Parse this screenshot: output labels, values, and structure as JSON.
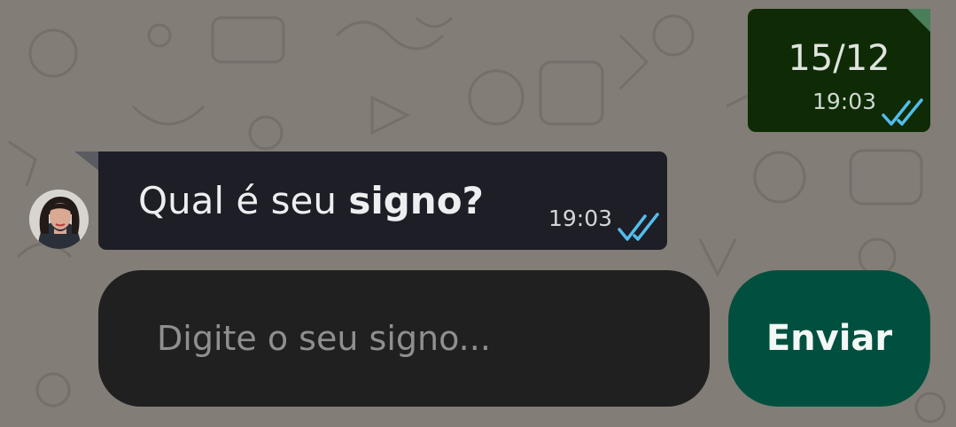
{
  "chat": {
    "outgoing_message": {
      "text": "15/12",
      "time": "19:03",
      "status_icon": "double-check-read-icon"
    },
    "incoming_message": {
      "text_plain": "Qual é seu ",
      "text_bold": "signo?",
      "time": "19:03",
      "status_icon": "double-check-read-icon",
      "sender_avatar": "avatar"
    }
  },
  "composer": {
    "value": "",
    "placeholder": "Digite o seu signo...",
    "send_label": "Enviar"
  },
  "colors": {
    "background": "#827d76",
    "outgoing_bubble": "#0e2b05",
    "incoming_bubble": "#1d1e26",
    "input_background": "#202020",
    "send_button": "#01503f",
    "read_ticks": "#53bdeb"
  }
}
